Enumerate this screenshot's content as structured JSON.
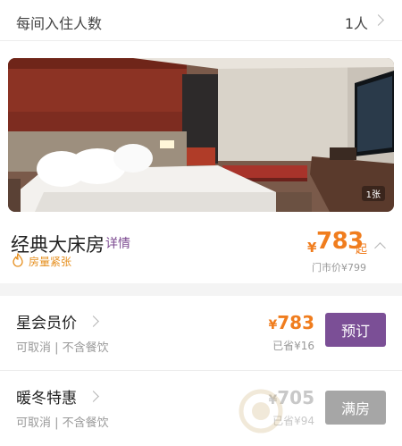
{
  "guests": {
    "label": "每间入住人数",
    "value": "1人"
  },
  "photo": {
    "count": "1张"
  },
  "room": {
    "name": "经典大床房",
    "detail_link": "详情",
    "scarcity": "房量紧张",
    "price_currency": "¥",
    "price_value": "783",
    "price_suffix": "起",
    "market_price": "门市价¥799"
  },
  "rates": [
    {
      "name": "星会员价",
      "policy": "可取消 | 不含餐饮",
      "currency": "¥",
      "price": "783",
      "saved": "已省¥16",
      "button": "预订",
      "available": true
    },
    {
      "name": "暖冬特惠",
      "policy": "可取消 | 不含餐饮",
      "currency": "¥",
      "price": "705",
      "saved": "已省¥94",
      "button": "满房",
      "available": false
    }
  ],
  "colors": {
    "accent_purple": "#7b4f96",
    "price_orange": "#f07d1e",
    "disabled_gray": "#a6a6a6"
  },
  "icons": {
    "chevron": "chevron-right-icon",
    "fire": "fire-icon"
  }
}
